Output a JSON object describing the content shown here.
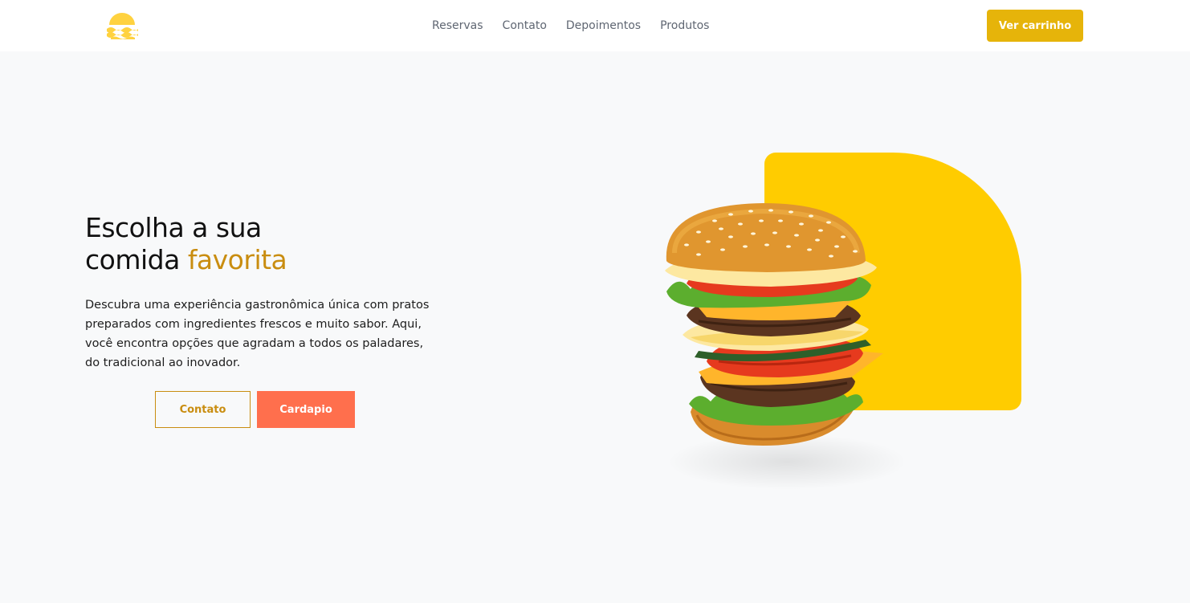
{
  "nav": {
    "logo_icon": "sun-waves-icon",
    "links": [
      {
        "label": "Reservas"
      },
      {
        "label": "Contato"
      },
      {
        "label": "Depoimentos"
      },
      {
        "label": "Produtos"
      }
    ],
    "cart_label": "Ver carrinho"
  },
  "hero": {
    "title_line1": "Escolha a sua",
    "title_line2_prefix": "comida ",
    "title_line2_highlight": "favorita",
    "description": "Descubra uma experiência gastronômica única com pratos preparados com ingredientes frescos e muito sabor. Aqui, você encontra opções que agradam a todos os paladares, do tradicional ao inovador.",
    "contact_label": "Contato",
    "menu_label": "Cardapio"
  },
  "colors": {
    "accent": "#e6b40a",
    "highlight": "#c98d10",
    "secondary": "#ff6f4d",
    "shape": "#ffcc00",
    "background": "#f8f9fa"
  }
}
